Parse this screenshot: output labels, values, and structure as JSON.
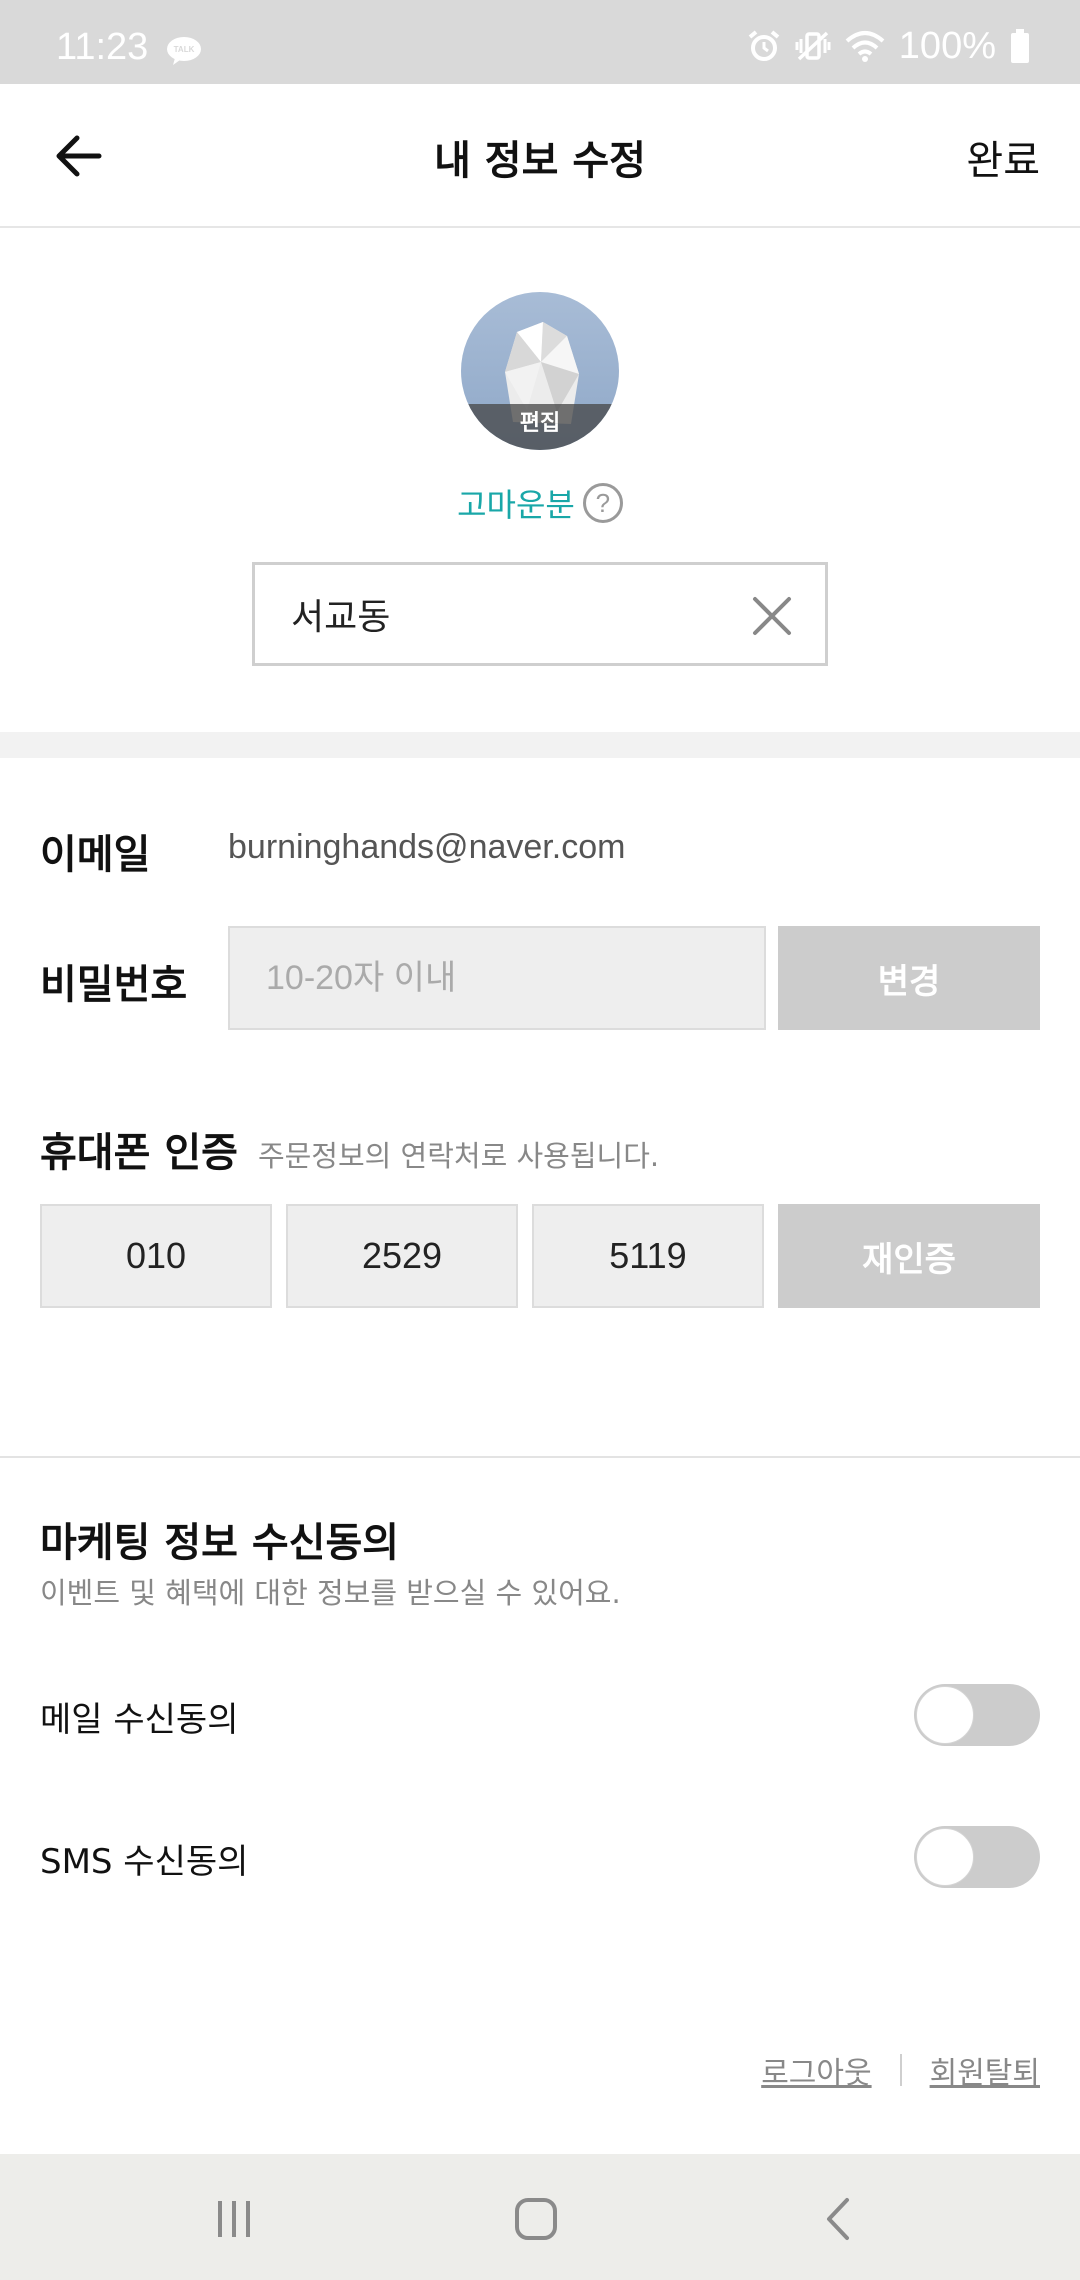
{
  "status_bar": {
    "time": "11:23",
    "battery": "100%",
    "icons": [
      "kakaotalk-icon",
      "alarm-icon",
      "vibrate-icon",
      "wifi-icon",
      "battery-icon"
    ]
  },
  "header": {
    "title": "내 정보 수정",
    "done_label": "완료"
  },
  "profile": {
    "edit_label": "편집",
    "grade": "고마운분",
    "nickname": "서교동"
  },
  "account": {
    "email_label": "이메일",
    "email_value": "burninghands@naver.com",
    "password_label": "비밀번호",
    "password_placeholder": "10-20자 이내",
    "password_change_label": "변경"
  },
  "phone": {
    "title": "휴대폰 인증",
    "subtitle": "주문정보의 연락처로 사용됩니다.",
    "part1": "010",
    "part2": "2529",
    "part3": "5119",
    "reverify_label": "재인증"
  },
  "marketing": {
    "title": "마케팅 정보 수신동의",
    "subtitle": "이벤트 및 혜택에 대한 정보를 받으실 수 있어요.",
    "mail_label": "메일 수신동의",
    "mail_on": false,
    "sms_label": "SMS 수신동의",
    "sms_on": false
  },
  "footer": {
    "logout_label": "로그아웃",
    "withdraw_label": "회원탈퇴"
  },
  "colors": {
    "accent": "#19a7a8",
    "disabled_button": "#cccccc",
    "status_bar": "#d9d9d9"
  }
}
